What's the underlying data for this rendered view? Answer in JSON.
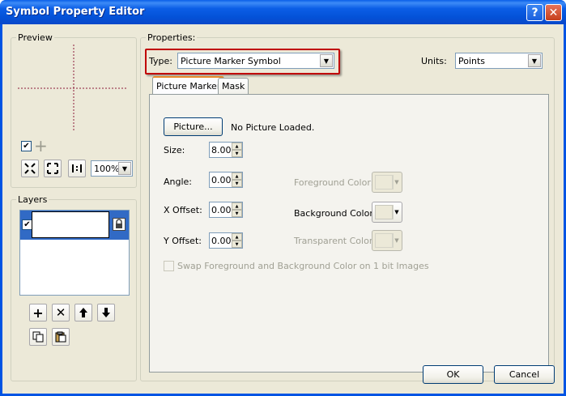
{
  "window": {
    "title": "Symbol Property Editor"
  },
  "titlebar": {
    "help_glyph": "?",
    "close_glyph": "✕"
  },
  "preview": {
    "label": "Preview",
    "zoom_value": "100%",
    "checkbox_checked": true
  },
  "layers": {
    "label": "Layers",
    "items": [
      {
        "checked": true
      }
    ]
  },
  "properties": {
    "label": "Properties:",
    "type_label": "Type:",
    "type_value": "Picture Marker Symbol",
    "units_label": "Units:",
    "units_value": "Points"
  },
  "tabs": [
    {
      "label": "Picture Marker",
      "active": true
    },
    {
      "label": "Mask",
      "active": false
    }
  ],
  "picture_marker": {
    "picture_button": "Picture...",
    "picture_status": "No Picture Loaded.",
    "size_label": "Size:",
    "size_value": "8.00",
    "angle_label": "Angle:",
    "angle_value": "0.00",
    "xoffset_label": "X Offset:",
    "xoffset_value": "0.00",
    "yoffset_label": "Y Offset:",
    "yoffset_value": "0.00",
    "foreground_label": "Foreground Color:",
    "background_label": "Background Color:",
    "transparent_label": "Transparent Color:",
    "swap_label": "Swap Foreground and Background Color on 1 bit Images"
  },
  "footer": {
    "ok_label": "OK",
    "cancel_label": "Cancel"
  },
  "colors": {
    "titlebar": "#0054e3",
    "dialog_bg": "#ece9d8",
    "highlight_box": "#c00000",
    "selection": "#316ac5",
    "tab_accent": "#e68b2c"
  }
}
